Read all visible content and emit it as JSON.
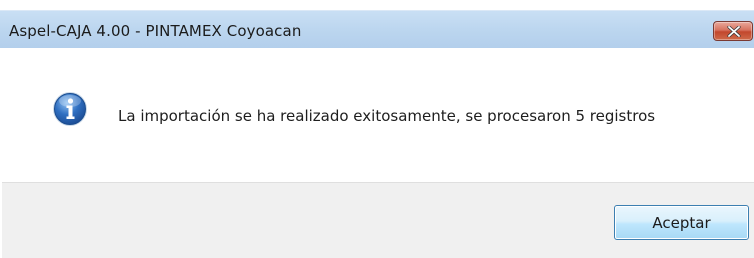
{
  "window": {
    "title": "Aspel-CAJA 4.00 - PINTAMEX Coyoacan",
    "close_icon": "close-icon"
  },
  "dialog": {
    "icon": "info-icon",
    "message": "La importación se ha realizado exitosamente, se procesaron 5 registros"
  },
  "buttons": {
    "accept_label": "Aceptar"
  },
  "colors": {
    "titlebar": "#bcd6ef",
    "close_button": "#c2472d",
    "info_icon": "#2f6fc1",
    "footer": "#f0f0f0",
    "accept_border": "#3c7fb1"
  }
}
